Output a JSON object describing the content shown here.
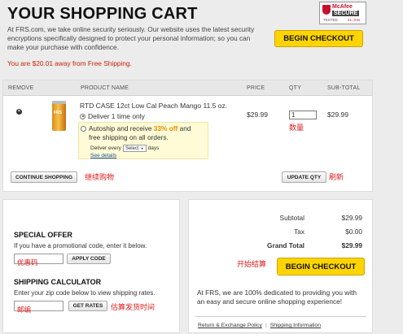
{
  "header": {
    "title": "YOUR SHOPPING CART",
    "intro": "At FRS.com, we take online security seriously. Our website uses the latest security encryptions specifically designed to protect your personal information; so you can make your purchase with confidence.",
    "shipping_notice": "You are $20.01 away from Free Shipping."
  },
  "badge": {
    "brand": "McAfee",
    "secure": "SECURE",
    "tested": "TESTED",
    "date": "21-JAN"
  },
  "checkout": {
    "label": "BEGIN CHECKOUT"
  },
  "cart": {
    "columns": {
      "remove": "REMOVE",
      "product": "PRODUCT NAME",
      "price": "PRICE",
      "qty": "QTY",
      "subtotal": "SUB-TOTAL"
    },
    "item": {
      "remove_glyph": "×",
      "can_label": "FRS",
      "name": "RTD CASE 12ct Low Cal Peach Mango 11.5 oz.",
      "option_once": "Deliver 1 time only",
      "autoship_pre": "Autoship and receive ",
      "autoship_off": "33% off",
      "autoship_post": " and",
      "autoship_line2": "free shipping on all orders.",
      "deliver_every": "Deliver every",
      "select_value": "Select",
      "days": "days",
      "see_details": "See details",
      "price": "$29.99",
      "qty": "1",
      "subtotal": "$29.99"
    },
    "continue_label": "CONTINUE SHOPPING",
    "update_label": "UPDATE QTY"
  },
  "annotations": {
    "qty": "数量",
    "continue": "继续购物",
    "update": "刷新",
    "promo": "优惠码",
    "zip": "邮编",
    "rates": "估算发货时间",
    "checkout": "开始结算"
  },
  "offer": {
    "title": "SPECIAL OFFER",
    "desc": "If you have a promotional code, enter it below.",
    "apply_label": "APPLY CODE"
  },
  "shipping_calc": {
    "title": "SHIPPING CALCULATOR",
    "desc": "Enter your zip code below to view shipping rates.",
    "rates_label": "GET RATES"
  },
  "totals": {
    "subtotal_label": "Subtotal",
    "subtotal_value": "$29.99",
    "tax_label": "Tax",
    "tax_value": "$0.00",
    "grand_label": "Grand Total",
    "grand_value": "$29.99",
    "assurance": "At FRS, we are 100% dedicated to providing you with an easy and secure online shopping experience!",
    "link_returns": "Return & Exchange Policy",
    "separator": "|",
    "link_shipping": "Shipping Information"
  }
}
